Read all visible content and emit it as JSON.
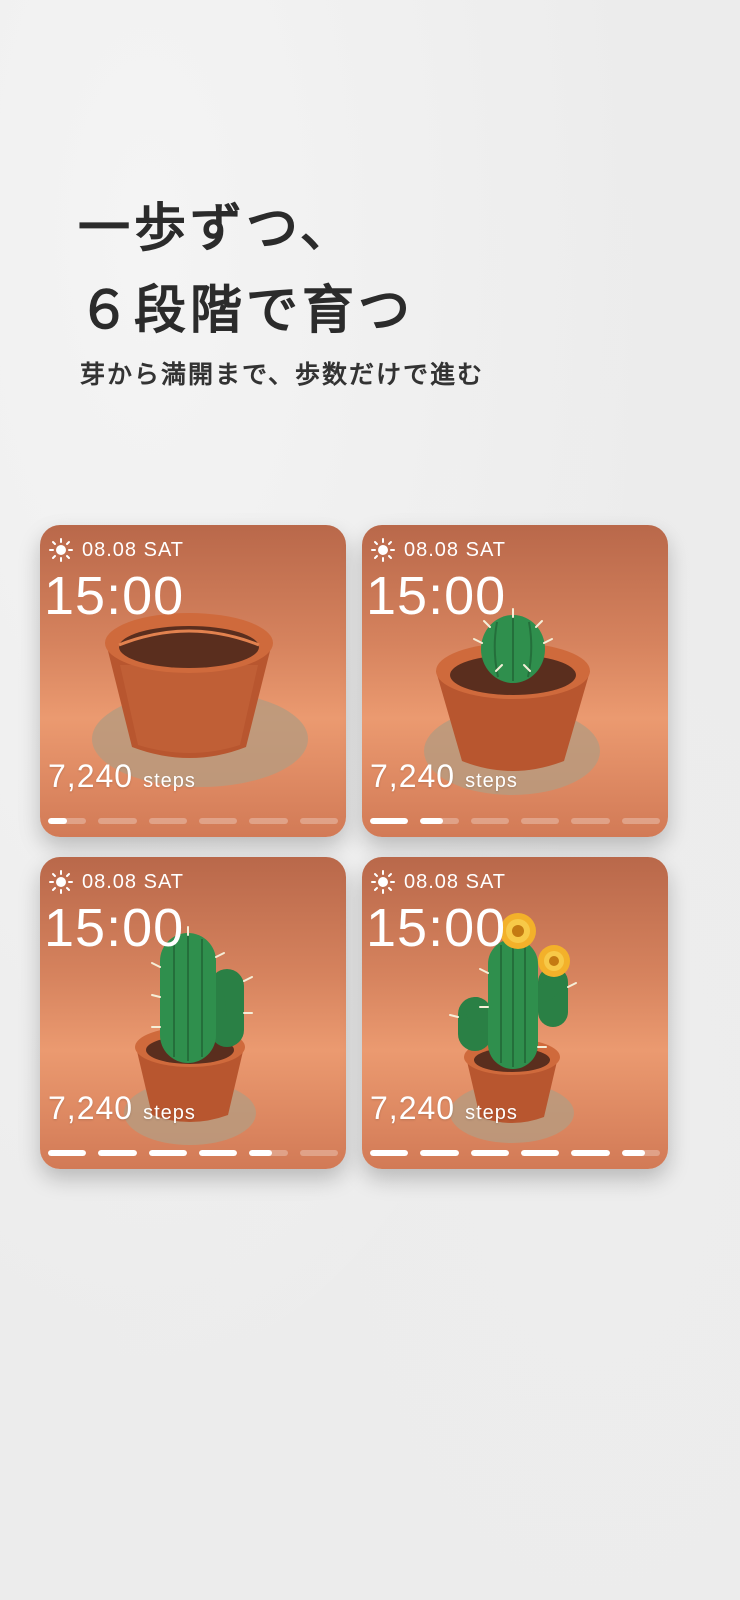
{
  "headline": {
    "line1": "一歩ずつ、",
    "line2": "６段階で育つ"
  },
  "subheadline": "芽から満開まで、歩数だけで進む",
  "cards": [
    {
      "date": "08.08 SAT",
      "time": "15:00",
      "steps": "7,240",
      "unit": "steps",
      "progress": [
        0.5,
        0,
        0,
        0,
        0,
        0
      ],
      "stage": "empty-pot"
    },
    {
      "date": "08.08 SAT",
      "time": "15:00",
      "steps": "7,240",
      "unit": "steps",
      "progress": [
        1,
        0.6,
        0,
        0,
        0,
        0
      ],
      "stage": "sprout"
    },
    {
      "date": "08.08 SAT",
      "time": "15:00",
      "steps": "7,240",
      "unit": "steps",
      "progress": [
        1,
        1,
        1,
        1,
        0.6,
        0
      ],
      "stage": "grown"
    },
    {
      "date": "08.08 SAT",
      "time": "15:00",
      "steps": "7,240",
      "unit": "steps",
      "progress": [
        1,
        1,
        1,
        1,
        1,
        0.6
      ],
      "stage": "bloom"
    }
  ],
  "colors": {
    "text": "#2b2b2b",
    "card_top": "#b9684a",
    "card_mid": "#eb9a70",
    "pot": "#b8562f",
    "cactus": "#2f8f4d",
    "flower": "#f3b12a"
  },
  "icons": {
    "weather": "sun-icon"
  }
}
